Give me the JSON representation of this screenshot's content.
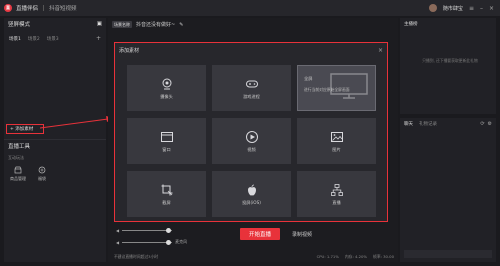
{
  "titlebar": {
    "app_name": "直播伴侣",
    "mode_label": "抖音短视频",
    "user_name": "随市肆宝"
  },
  "left_panel": {
    "title": "竖屏模式",
    "scene_tabs": [
      "场景1",
      "场景2",
      "场景3"
    ],
    "add_source_label": "+ 添加素材"
  },
  "live_tools": {
    "title": "直播工具",
    "subtitle": "互动玩法",
    "items": [
      {
        "label": "商品管理",
        "icon": "shop-icon"
      },
      {
        "label": "福袋",
        "icon": "gift-icon"
      }
    ]
  },
  "center": {
    "badge": "场景名称",
    "title": "抖音还没有做好~",
    "bottom": {
      "start_button": "开始直播",
      "record_label": "录制视频",
      "mic_label": "麦克风",
      "status_left": "不建议直播时间超过3小时",
      "cpu": "CPU: 1.71%",
      "mem": "内存: 4.20%",
      "fps": "帧率: 30.00"
    }
  },
  "right_top": {
    "title": "主播榜",
    "empty_text": "只播到, 还下播要获取更新此礼物"
  },
  "right_bottom": {
    "tabs": [
      "聊天",
      "礼物记录"
    ]
  },
  "modal": {
    "title": "添加素材",
    "tiles": [
      {
        "label": "摄像头",
        "icon": "webcam-icon"
      },
      {
        "label": "游戏进程",
        "icon": "gamepad-icon"
      },
      {
        "label": "全屏",
        "desc": "进行当前对应原始全屏画面",
        "icon": "monitor-icon",
        "selected": true
      },
      {
        "label": "窗口",
        "icon": "window-icon"
      },
      {
        "label": "视频",
        "icon": "play-icon"
      },
      {
        "label": "图片",
        "icon": "image-icon"
      },
      {
        "label": "截屏",
        "icon": "screenshot-icon"
      },
      {
        "label": "投屏(iOS)",
        "icon": "apple-icon"
      },
      {
        "label": "直播",
        "icon": "network-icon"
      }
    ]
  },
  "colors": {
    "accent": "#e8323a",
    "background": "#1a1a1e",
    "panel": "#212126"
  }
}
